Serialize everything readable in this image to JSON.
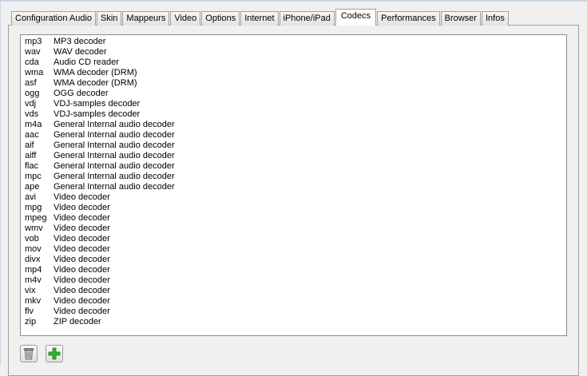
{
  "tabs": [
    {
      "label": "Configuration Audio",
      "selected": false
    },
    {
      "label": "Skin",
      "selected": false
    },
    {
      "label": "Mappeurs",
      "selected": false
    },
    {
      "label": "Video",
      "selected": false
    },
    {
      "label": "Options",
      "selected": false
    },
    {
      "label": "Internet",
      "selected": false
    },
    {
      "label": "iPhone/iPad",
      "selected": false
    },
    {
      "label": "Codecs",
      "selected": true
    },
    {
      "label": "Performances",
      "selected": false
    },
    {
      "label": "Browser",
      "selected": false
    },
    {
      "label": "Infos",
      "selected": false
    }
  ],
  "codecs": [
    [
      "mp3",
      "MP3 decoder"
    ],
    [
      "wav",
      "WAV decoder"
    ],
    [
      "cda",
      "Audio CD reader"
    ],
    [
      "wma",
      "WMA decoder (DRM)"
    ],
    [
      "asf",
      "WMA decoder (DRM)"
    ],
    [
      "ogg",
      "OGG decoder"
    ],
    [
      "vdj",
      "VDJ-samples decoder"
    ],
    [
      "vds",
      "VDJ-samples decoder"
    ],
    [
      "m4a",
      "General Internal audio decoder"
    ],
    [
      "aac",
      "General Internal audio decoder"
    ],
    [
      "aif",
      "General Internal audio decoder"
    ],
    [
      "aiff",
      "General Internal audio decoder"
    ],
    [
      "flac",
      "General Internal audio decoder"
    ],
    [
      "mpc",
      "General Internal audio decoder"
    ],
    [
      "ape",
      "General Internal audio decoder"
    ],
    [
      "avi",
      "Video decoder"
    ],
    [
      "mpg",
      "Video decoder"
    ],
    [
      "mpeg",
      "Video decoder"
    ],
    [
      "wmv",
      "Video decoder"
    ],
    [
      "vob",
      "Video decoder"
    ],
    [
      "mov",
      "Video decoder"
    ],
    [
      "divx",
      "Video decoder"
    ],
    [
      "mp4",
      "Video decoder"
    ],
    [
      "m4v",
      "Video decoder"
    ],
    [
      "vix",
      "Video decoder"
    ],
    [
      "mkv",
      "Video decoder"
    ],
    [
      "flv",
      "Video decoder"
    ],
    [
      "zip",
      "ZIP decoder"
    ]
  ],
  "buttons": {
    "delete_icon": "trash-icon",
    "add_icon": "plus-icon",
    "add_color": "#2fb52f"
  }
}
